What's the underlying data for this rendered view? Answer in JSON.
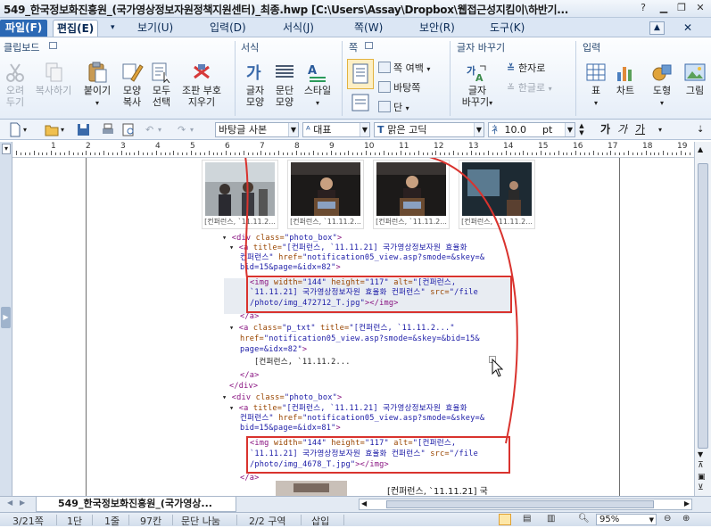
{
  "window": {
    "title": "549_한국정보화진흥원_(국가영상정보자원정책지원센터)_최종.hwp  [C:\\Users\\Assay\\Dropbox\\웹접근성지킴이\\하반기..."
  },
  "menu": {
    "file": "파일(F)",
    "edit": "편집(E)",
    "view": "보기(U)",
    "input": "입력(D)",
    "format": "서식(J)",
    "page": "쪽(W)",
    "security": "보안(R)",
    "tools": "도구(K)"
  },
  "ribbon": {
    "clipboard": {
      "title": "클립보드",
      "cut": [
        "오려",
        "두기"
      ],
      "copy": "복사하기",
      "paste": "붙이기",
      "copy_style": [
        "모양",
        "복사"
      ],
      "select_all": [
        "모두",
        "선택"
      ],
      "clear_format": [
        "조판 부호",
        "지우기"
      ]
    },
    "format": {
      "title": "서식",
      "char_shape": [
        "글자",
        "모양"
      ],
      "para_shape": [
        "문단",
        "모양"
      ],
      "style": "스타일"
    },
    "page": {
      "title": "쪽",
      "page_margin": "쪽 여백",
      "background": "바탕쪽",
      "columns": "단"
    },
    "find_replace": {
      "title": "글자 바꾸기",
      "hanja": "한자로",
      "hangul": "한글로",
      "change_char": [
        "글자",
        "바꾸기"
      ]
    },
    "insert": {
      "title": "입력",
      "table": "표",
      "chart": "차트",
      "shape": "도형",
      "picture": "그림"
    }
  },
  "toolbar": {
    "style": "바탕글 사본",
    "language": "대표",
    "font": "맑은 고딕",
    "size": "10.0",
    "unit": "pt",
    "bold_glyph": "가",
    "italic_glyph": "가",
    "underline_glyph": "가"
  },
  "ruler": {
    "numbers": [
      "1",
      "2",
      "3",
      "4",
      "5",
      "6",
      "7",
      "8",
      "9",
      "10",
      "11",
      "12",
      "13",
      "14",
      "15",
      "16",
      "17",
      "18",
      "19"
    ]
  },
  "document": {
    "thumb_captions": [
      "[컨퍼런스, `11.11.2...",
      "[컨퍼런스, `11.11.2...",
      "[컨퍼런스, `11.11.2...",
      "[컨퍼런스, `11.11.2..."
    ],
    "code": {
      "l1_tag": "<div",
      "l1_attr": " class=",
      "l1_val": "\"photo_box\"",
      "l1_end": ">",
      "l2_tag": "<a",
      "l2_attr": " title=",
      "l2_val": "\"[컨퍼런스, `11.11.21] 국가영상정보자원 효율화",
      "l3_val": "컨퍼런스\"",
      "l3_attr": " href=",
      "l3_val2": "\"notification05_view.asp?smode=&skey=&",
      "l4_val": "bid=15&page=&idx=82\"",
      "l4_end": ">",
      "l5_tag": "<img",
      "l5_attr": " width=",
      "l5_val": "\"144\"",
      "l5_attr2": " height=",
      "l5_val2": "\"117\"",
      "l5_attr3": " alt=",
      "l5_val3": "\"[컨퍼런스,",
      "l6_val": "`11.11.21] 국가영상정보자원 효율화 컨퍼런스\"",
      "l6_attr": " src=",
      "l6_val2": "\"/file",
      "l7_val": "/photo/img_472712_T.jpg\"",
      "l7_tag": "></img>",
      "l8_tag": "</a>",
      "l9_tag": "<a",
      "l9_attr": " class=",
      "l9_val": "\"p_txt\"",
      "l9_attr2": " title=",
      "l9_val2": "\"[컨퍼런스, `11.11.2...\"",
      "l10_attr": "href=",
      "l10_val": "\"notification05_view.asp?smode=&skey=&bid=15&",
      "l11_val": "page=&idx=82\"",
      "l11_end": ">",
      "l12_text": "[컨퍼런스, `11.11.2...",
      "l13_tag": "</a>",
      "l14_tag": "</div>",
      "l15_tag": "<div",
      "l15_attr": " class=",
      "l15_val": "\"photo_box\"",
      "l15_end": ">",
      "l16_tag": "<a",
      "l16_attr": " title=",
      "l16_val": "\"[컨퍼런스, `11.11.21] 국가영상정보자원 효율화",
      "l17_val": "컨퍼런스\"",
      "l17_attr": " href=",
      "l17_val2": "\"notification05_view.asp?smode=&skey=&",
      "l18_val": "bid=15&page=&idx=81\"",
      "l18_end": ">",
      "l19_tag": "<img",
      "l19_attr": " width=",
      "l19_val": "\"144\"",
      "l19_attr2": " height=",
      "l19_val2": "\"117\"",
      "l19_attr3": " alt=",
      "l19_val3": "\"[컨퍼런스,",
      "l20_val": "`11.11.21] 국가영상정보자원 효율화 컨퍼런스\"",
      "l20_attr": " src=",
      "l20_val2": "\"/file",
      "l21_val": "/photo/img_4678_T.jpg\"",
      "l21_tag": "></img>",
      "l22_tag": "</a>"
    },
    "bottom_caption": "[컨퍼런스, `11.11.21] 국"
  },
  "doc_tab": {
    "name": "549_한국정보화진흥원_(국가영상..."
  },
  "status": {
    "page": "3/21쪽",
    "column": "1단",
    "line": "1줄",
    "char": "97칸",
    "para_break": "문단 나눔",
    "section": "2/2 구역",
    "insert_mode": "삽입",
    "zoom": "95%"
  },
  "colors": {
    "accent": "#2b69b5",
    "highlight": "#d9332e"
  }
}
